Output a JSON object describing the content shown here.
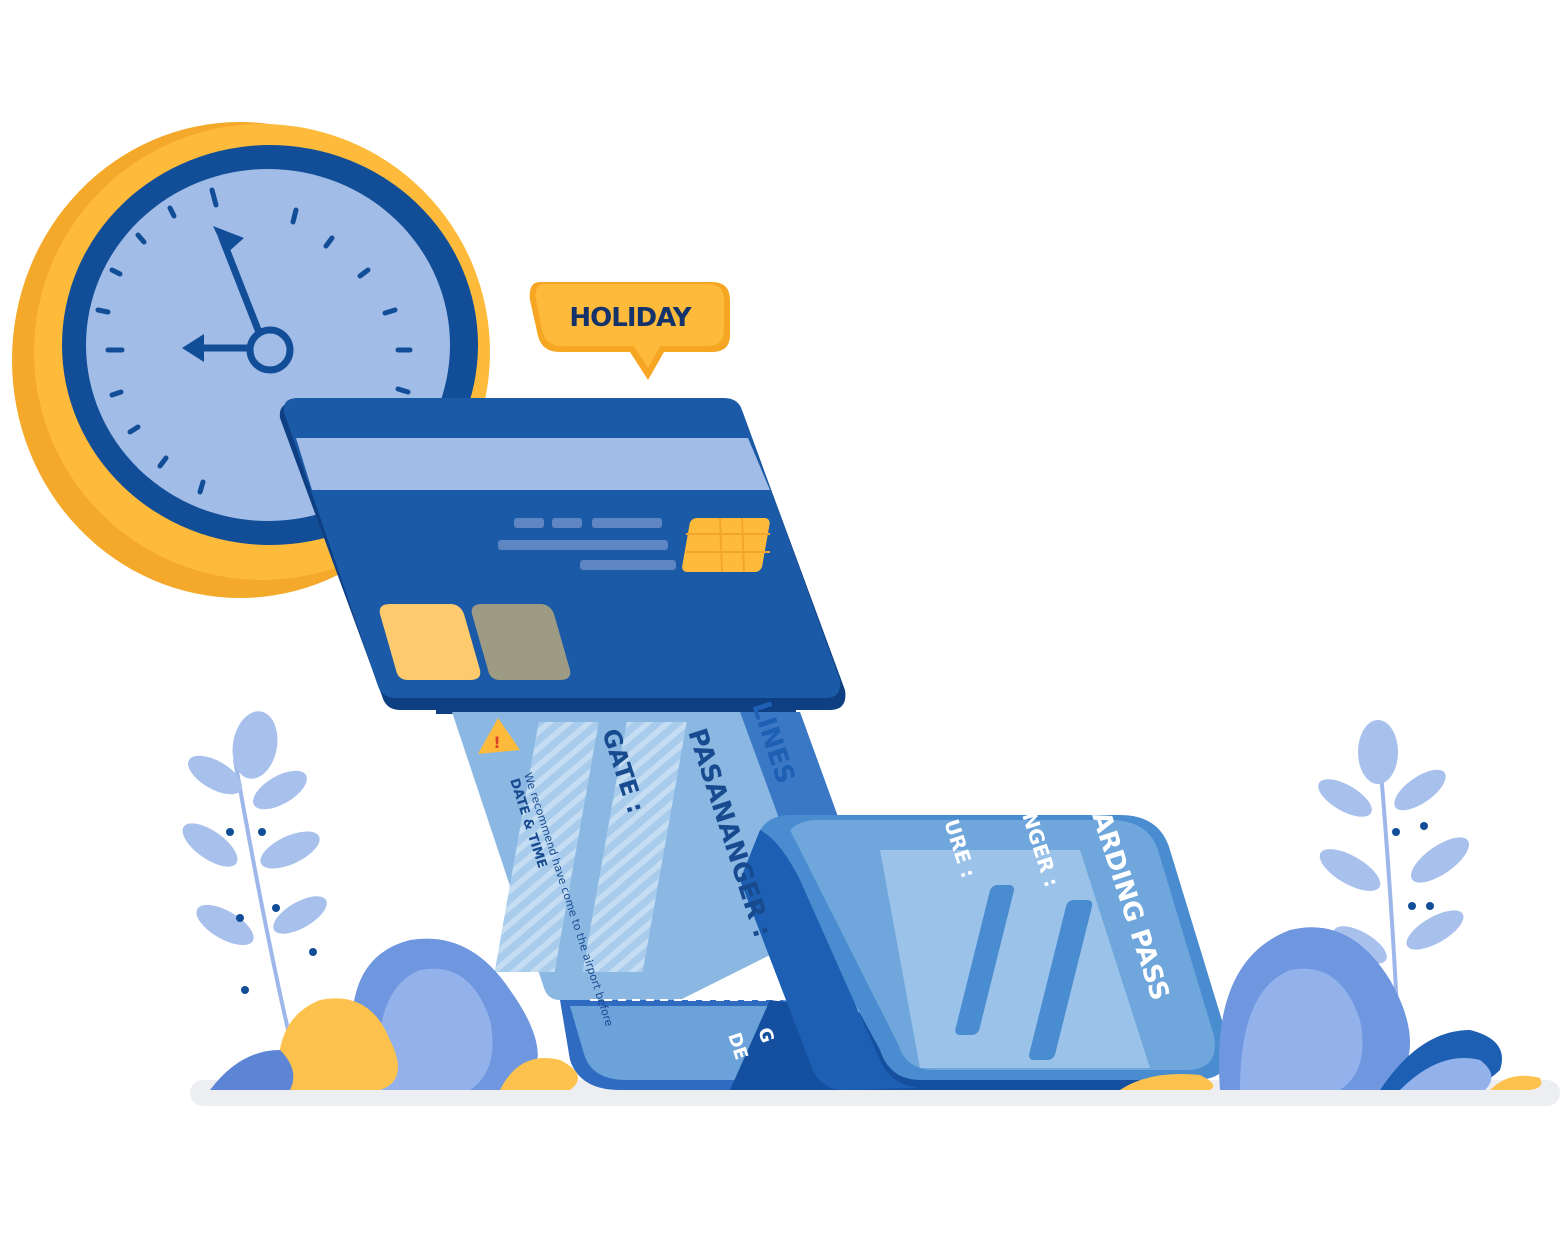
{
  "speech_bubble": {
    "text": "HOLIDAY"
  },
  "ticket": {
    "airline_fragment": "LINES",
    "passenger_label": "PASANANGER :",
    "gate_label": "GATE :",
    "note": "We recommend have come to the airport before",
    "datetime_label": "DATE & TIME",
    "stub_fragment_1": "G",
    "stub_fragment_2": "DE",
    "boarding_pass_fragment": "ARDING PASS",
    "passenger_fragment": "NGER :",
    "departure_fragment": "URE :"
  },
  "colors": {
    "clock_rim": "#FDBA3B",
    "clock_face": "#A2BCE8",
    "navy": "#114E97",
    "card_blue": "#1A5AA6",
    "ticket_light": "#8BB8E2",
    "ticket_mid": "#4A8CD0",
    "leaf_blue": "#6F97E0",
    "leaf_yellow": "#FDC24E",
    "ground": "#EDEEF1"
  }
}
